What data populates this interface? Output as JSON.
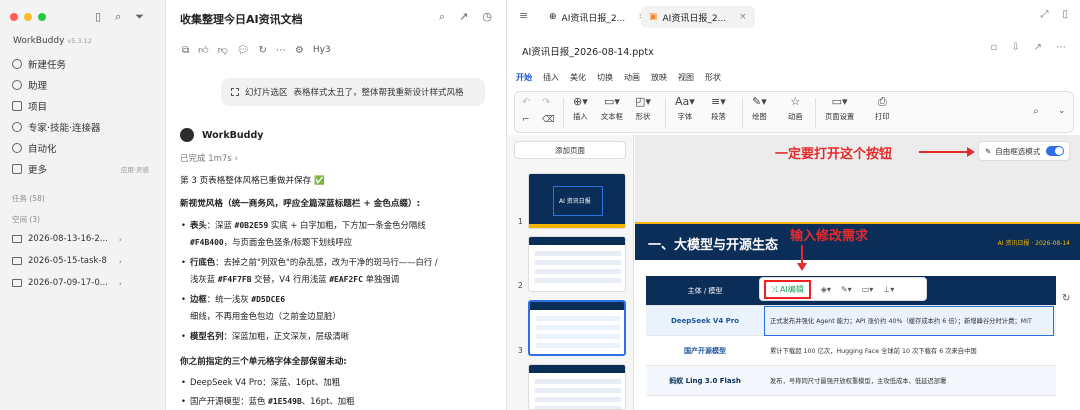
{
  "colors": {
    "accent": "#2f6fe4",
    "dark_navy": "#0B2E59",
    "gold": "#F4B400",
    "annotation": "#e32b2b"
  },
  "sidebar": {
    "app_name": "WorkBuddy",
    "version": "v5.3.12",
    "items": [
      {
        "label": "新建任务",
        "icon": "plus-circle-icon"
      },
      {
        "label": "助理",
        "icon": "assistant-icon"
      },
      {
        "label": "项目",
        "icon": "project-icon"
      },
      {
        "label": "专家·技能·连接器",
        "icon": "expert-icon"
      },
      {
        "label": "自动化",
        "icon": "clock-icon"
      },
      {
        "label": "更多",
        "icon": "more-icon",
        "meta": "应用·灵感"
      }
    ],
    "tasks_label": "任务 (58)",
    "space_label": "空间 (3)",
    "folders": [
      "2026-08-13-16-2...",
      "2026-05-15-task-8",
      "2026-07-09-17-0..."
    ]
  },
  "chat": {
    "title": "收集整理今日AI资讯文档",
    "model": "Hy3",
    "user_msg_prefix": "幻灯片选区",
    "user_msg": "表格样式太丑了，整体帮我重新设计样式风格",
    "assistant": "WorkBuddy",
    "status": "已完成 1m7s",
    "line1": "第 3 页表格整体风格已重做并保存 ✅",
    "heading1": "新视觉风格（统一商务风，呼应全篇深蓝标题栏 + 金色点缀）:",
    "b1_label": "表头",
    "b1_a": "：深蓝 ",
    "b1_c1": "#0B2E59",
    "b1_b": " 实底 + 白字加粗，下方加一条金色分隔线",
    "b1_c2": "#F4B400",
    "b1_c": "，与页面金色竖条/标题下划线呼应",
    "b2_label": "行底色",
    "b2_a": "：去掉之前\"列双色\"的杂乱感，改为干净的斑马行——白行 /",
    "b2_b": "浅灰蓝 ",
    "b2_c1": "#F4F7FB",
    "b2_c": " 交替，V4 行用浅蓝 ",
    "b2_c2": "#EAF2FC",
    "b2_d": " 单独强调",
    "b3_label": "边框",
    "b3_a": "：统一浅灰 ",
    "b3_c1": "#D5DCE6",
    "b3_b": "细线，不再用金色包边（之前金边显脏）",
    "b4_label": "模型名列",
    "b4_a": "：深蓝加粗，正文深灰，层级清晰",
    "heading2": "你之前指定的三个单元格字体全部保留未动:",
    "k1": "DeepSeek V4 Pro：深蓝、16pt、加粗",
    "k2_a": "国产开源模型：蓝色 ",
    "k2_c": "#1E549B",
    "k2_b": "、16pt、加粗"
  },
  "editor": {
    "tabs": [
      {
        "label": "AI资讯日报_2...",
        "icon": "globe-icon"
      },
      {
        "label": "AI资讯日报_2...",
        "icon": "slides-icon"
      }
    ],
    "file_title": "AI资讯日报_2026-08-14.pptx",
    "menu": [
      "开始",
      "插入",
      "美化",
      "切换",
      "动画",
      "放映",
      "视图",
      "形状"
    ],
    "ribbon": [
      "插入",
      "文本框",
      "形状",
      "字体",
      "段落",
      "绘图",
      "动画",
      "页面设置",
      "打印"
    ],
    "add_page": "添加页面",
    "thumb_nums": [
      "1",
      "2",
      "3"
    ],
    "thumb1_title": "AI 资讯日报",
    "toggle_label": "自由框选模式",
    "toggle_on": true,
    "ai_edit": "AI编辑",
    "annot_toggle": "一定要打开这个按钮",
    "annot_input": "输入修改需求",
    "slide": {
      "heading": "一、大模型与开源生态",
      "date": "AI 资讯日报 · 2026-08-14",
      "header_col": "主体 / 模型",
      "rows": [
        {
          "name": "DeepSeek V4 Pro",
          "desc": "正式发布并强化 Agent 能力；API 涨价约 40%（缓存成本约 6 倍）；新增峰谷分时计费；MIT"
        },
        {
          "name": "国产开源模型",
          "desc": "累计下载超 100 亿次，Hugging Face 全球前 10 次下载有 6 次来自中国"
        },
        {
          "name": "蚂蚁 Ling 3.0 Flash",
          "desc": "发布，号称同尺寸最强开放权重模型，主攻低成本、低延迟部署"
        }
      ]
    }
  }
}
